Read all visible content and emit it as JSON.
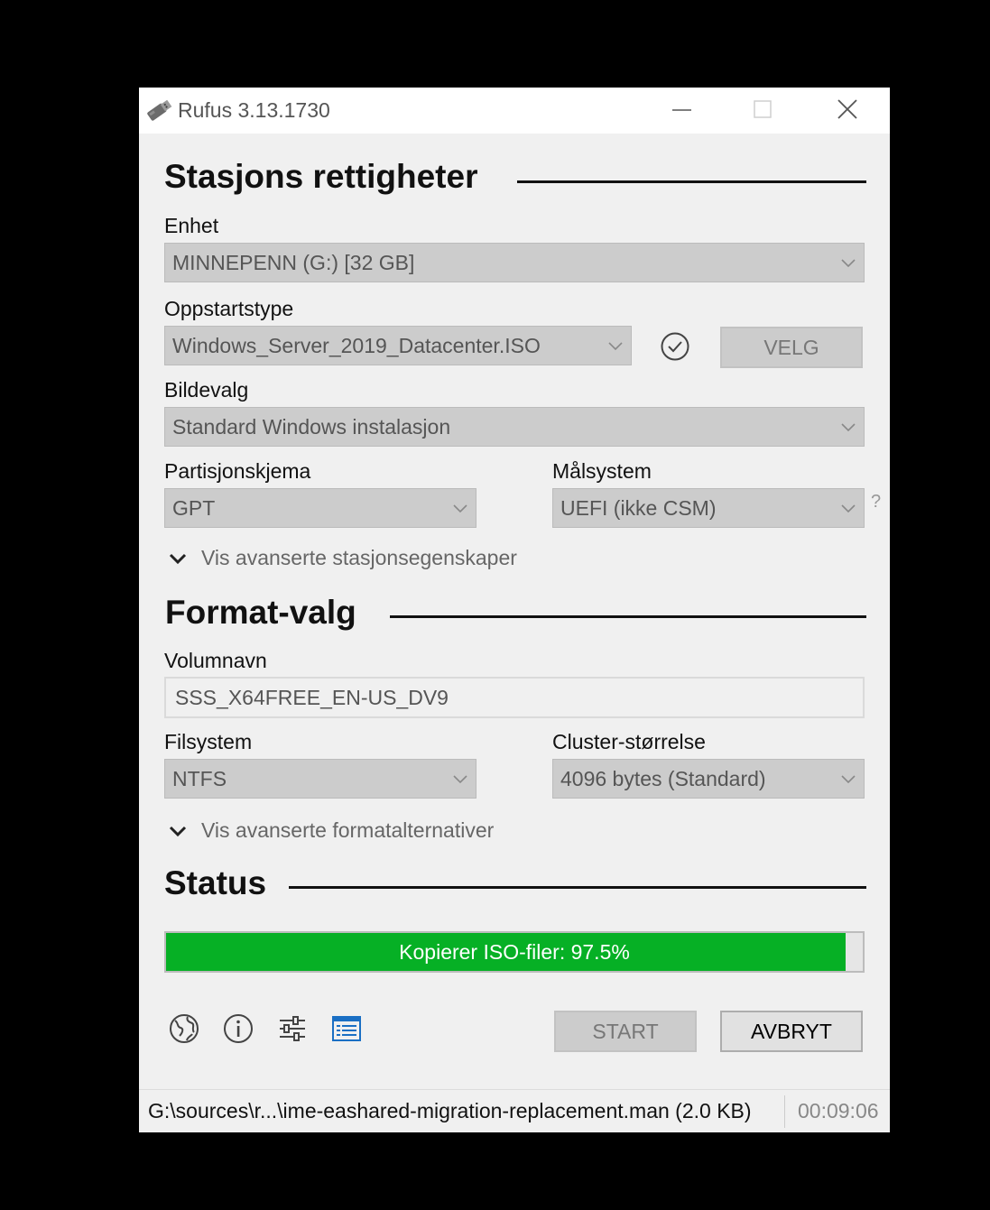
{
  "window": {
    "title": "Rufus 3.13.1730"
  },
  "drive_section": {
    "title": "Stasjons rettigheter",
    "device_label": "Enhet",
    "device_value": "MINNEPENN (G:) [32 GB]",
    "boot_label": "Oppstartstype",
    "boot_value": "Windows_Server_2019_Datacenter.ISO",
    "select_button": "VELG",
    "image_label": "Bildevalg",
    "image_value": "Standard Windows instalasjon",
    "partition_label": "Partisjonskjema",
    "partition_value": "GPT",
    "target_label": "Målsystem",
    "target_value": "UEFI (ikke CSM)",
    "help_mark": "?",
    "advanced_toggle": "Vis avanserte stasjonsegenskaper"
  },
  "format_section": {
    "title": "Format-valg",
    "volume_label": "Volumnavn",
    "volume_value": "SSS_X64FREE_EN-US_DV9",
    "fs_label": "Filsystem",
    "fs_value": "NTFS",
    "cluster_label": "Cluster-størrelse",
    "cluster_value": "4096 bytes (Standard)",
    "advanced_toggle": "Vis avanserte formatalternativer"
  },
  "status_section": {
    "title": "Status",
    "progress_text": "Kopierer ISO-filer: 97.5%",
    "progress_percent": 97.5
  },
  "toolbar": {
    "icons": [
      "globe-icon",
      "info-icon",
      "settings-sliders-icon",
      "log-icon"
    ],
    "start_label": "START",
    "cancel_label": "AVBRYT"
  },
  "statusbar": {
    "message": "G:\\sources\\r...\\ime-eashared-migration-replacement.man (2.0 KB)",
    "timer": "00:09:06"
  },
  "colors": {
    "progress_fill": "#06b025",
    "disabled_field": "#cccccc",
    "window_bg": "#f0f0f0",
    "log_icon": "#1a6fc4"
  }
}
